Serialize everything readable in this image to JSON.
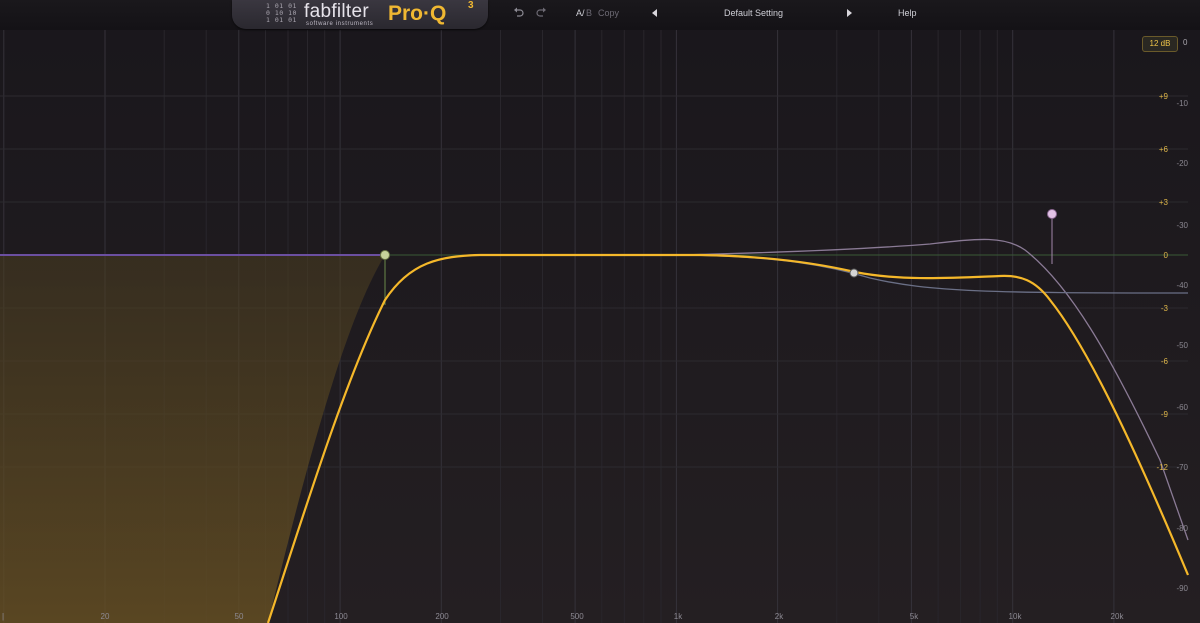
{
  "header": {
    "brand": "fabfilter",
    "brand_sub": "software instruments",
    "product": "Pro·Q",
    "product_version": "3",
    "undo_icon": "undo-icon",
    "redo_icon": "redo-icon",
    "ab_a": "A/",
    "ab_b": "B",
    "copy_label": "Copy",
    "prev_preset_icon": "triangle-left-icon",
    "preset_name": "Default Setting",
    "next_preset_icon": "triangle-right-icon",
    "help_label": "Help"
  },
  "display": {
    "range_label": "12 dB",
    "spectrum_zero": "0",
    "gain_scale": [
      "+9",
      "+6",
      "+3",
      "0",
      "-3",
      "-6",
      "-9",
      "-12"
    ],
    "spectrum_scale": [
      "-10",
      "-20",
      "-30",
      "-40",
      "-50",
      "-60",
      "-70",
      "-80",
      "-90"
    ],
    "freq_scale": [
      "20",
      "50",
      "100",
      "200",
      "500",
      "1k",
      "2k",
      "5k",
      "10k",
      "20k"
    ],
    "left_edge_label": "|"
  },
  "colors": {
    "background": "#1e1b1f",
    "eq_curve": "#f5b82a",
    "band1_node": "#c7d39a",
    "band2_node": "#d4d4d4",
    "band3_node": "#e2c2e6",
    "band3_curve": "#8a7a95",
    "band2_curve": "#6a6f86",
    "reference_line": "#6b4fa0"
  },
  "bands": [
    {
      "name": "band-1",
      "type": "low cut",
      "freq_hz": 133,
      "gain_db": 0
    },
    {
      "name": "band-2",
      "type": "high shelf",
      "freq_hz": 3500,
      "gain_db": -1.5
    },
    {
      "name": "band-3",
      "type": "bell",
      "freq_hz": 12400,
      "gain_db": 3.2
    }
  ]
}
